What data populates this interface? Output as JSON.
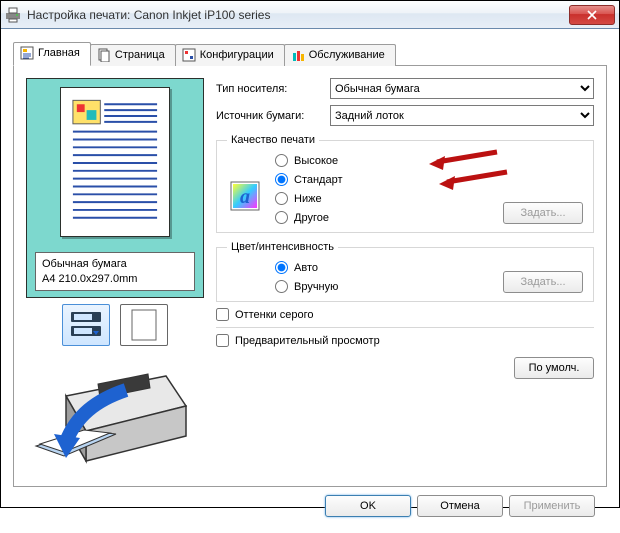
{
  "window": {
    "title": "Настройка печати: Canon Inkjet iP100 series"
  },
  "tabs": {
    "main": "Главная",
    "page": "Страница",
    "config": "Конфигурации",
    "service": "Обслуживание"
  },
  "preview": {
    "media": "Обычная бумага",
    "size": "A4 210.0x297.0mm"
  },
  "form": {
    "media_label": "Тип носителя:",
    "source_label": "Источник бумаги:",
    "media_value": "Обычная бумага",
    "source_value": "Задний лоток"
  },
  "quality": {
    "legend": "Качество печати",
    "high": "Высокое",
    "standard": "Стандарт",
    "low": "Ниже",
    "other": "Другое",
    "set_btn": "Задать..."
  },
  "color": {
    "legend": "Цвет/интенсивность",
    "auto": "Авто",
    "manual": "Вручную",
    "set_btn": "Задать..."
  },
  "checks": {
    "grayscale": "Оттенки серого",
    "preview": "Предварительный просмотр"
  },
  "buttons": {
    "defaults": "По умолч.",
    "ok": "OK",
    "cancel": "Отмена",
    "apply": "Применить"
  }
}
